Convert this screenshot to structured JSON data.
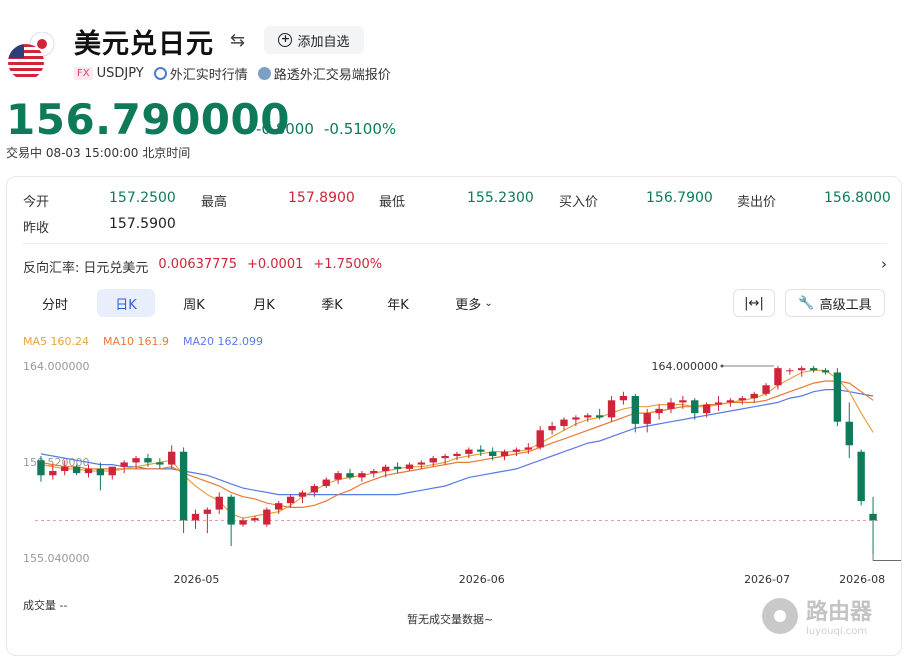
{
  "header": {
    "title": "美元兑日元",
    "add_watchlist": "添加自选",
    "fx_badge": "FX",
    "symbol": "USDJPY",
    "realtime": "外汇实时行情",
    "reuters": "路透外汇交易端报价",
    "price": "156.790000",
    "change": "-0.8000",
    "change_pct": "-0.5100%",
    "status": "交易中  08-03 15:00:00  北京时间"
  },
  "quote": {
    "open_label": "今开",
    "open": "157.2500",
    "high_label": "最高",
    "high": "157.8900",
    "low_label": "最低",
    "low": "155.2300",
    "bid_label": "买入价",
    "bid": "156.7900",
    "ask_label": "卖出价",
    "ask": "156.8000",
    "prev_label": "昨收",
    "prev": "157.5900"
  },
  "reverse": {
    "label": "反向汇率:",
    "pair": "日元兑美元",
    "rate": "0.00637775",
    "change": "+0.0001",
    "pct": "+1.7500%"
  },
  "tabs": [
    "分时",
    "日K",
    "周K",
    "月K",
    "季K",
    "年K",
    "更多"
  ],
  "tools": {
    "advanced": "高级工具"
  },
  "ma": {
    "ma5": "MA5 160.24",
    "ma10": "MA10 161.9",
    "ma20": "MA20 162.099"
  },
  "volume": {
    "label": "成交量 --",
    "empty": "暂无成交量数据~"
  },
  "watermark": {
    "text": "路由器",
    "sub": "luyouqi.com"
  },
  "colors": {
    "up": "#d0243a",
    "down": "#0e7a5a",
    "ma5": "#e8a33a",
    "ma10": "#e87a3a",
    "ma20": "#5a7ae8",
    "accent": "#2f5bd8"
  },
  "chart_data": {
    "type": "candlestick",
    "y_tick_labels": [
      "164.000000",
      "159.520000",
      "155.040000"
    ],
    "ylim": [
      155.04,
      164.0
    ],
    "x_tick_labels": [
      "2026-05",
      "2026-06",
      "2026-07",
      "2026-08"
    ],
    "annotations": {
      "max": "164.000000",
      "min": "155.040000"
    },
    "reference_line": 156.79,
    "candles": [
      [
        159.6,
        159.8,
        158.6,
        158.9
      ],
      [
        158.9,
        159.4,
        158.7,
        159.1
      ],
      [
        159.1,
        159.6,
        158.9,
        159.3
      ],
      [
        159.3,
        159.4,
        158.9,
        159.0
      ],
      [
        159.0,
        159.4,
        158.8,
        159.2
      ],
      [
        159.2,
        159.5,
        158.2,
        158.9
      ],
      [
        158.9,
        159.3,
        158.7,
        159.3
      ],
      [
        159.3,
        159.6,
        159.0,
        159.5
      ],
      [
        159.5,
        159.8,
        159.2,
        159.7
      ],
      [
        159.7,
        159.9,
        159.3,
        159.5
      ],
      [
        159.5,
        159.7,
        159.2,
        159.4
      ],
      [
        159.4,
        160.3,
        159.2,
        160.0
      ],
      [
        160.0,
        160.2,
        156.2,
        156.8
      ],
      [
        156.8,
        157.3,
        156.4,
        157.1
      ],
      [
        157.1,
        157.4,
        156.2,
        157.3
      ],
      [
        157.3,
        158.1,
        157.1,
        157.9
      ],
      [
        157.9,
        158.0,
        155.6,
        156.6
      ],
      [
        156.6,
        156.9,
        156.5,
        156.8
      ],
      [
        156.8,
        157.0,
        156.7,
        156.9
      ],
      [
        156.6,
        157.4,
        156.5,
        157.3
      ],
      [
        157.3,
        157.7,
        157.1,
        157.6
      ],
      [
        157.6,
        158.0,
        157.4,
        157.9
      ],
      [
        157.9,
        158.2,
        157.6,
        158.1
      ],
      [
        158.1,
        158.5,
        157.9,
        158.4
      ],
      [
        158.4,
        158.8,
        158.3,
        158.7
      ],
      [
        158.7,
        159.1,
        158.5,
        159.0
      ],
      [
        159.0,
        159.2,
        158.7,
        158.8
      ],
      [
        158.8,
        159.1,
        158.6,
        159.0
      ],
      [
        159.0,
        159.2,
        158.8,
        159.1
      ],
      [
        159.1,
        159.4,
        158.8,
        159.3
      ],
      [
        159.3,
        159.5,
        159.0,
        159.2
      ],
      [
        159.2,
        159.5,
        159.1,
        159.4
      ],
      [
        159.4,
        159.6,
        159.2,
        159.5
      ],
      [
        159.5,
        159.8,
        159.3,
        159.7
      ],
      [
        159.7,
        159.9,
        159.4,
        159.8
      ],
      [
        159.8,
        160.0,
        159.6,
        159.9
      ],
      [
        159.9,
        160.2,
        159.7,
        160.1
      ],
      [
        160.1,
        160.3,
        159.8,
        160.0
      ],
      [
        160.0,
        160.2,
        159.6,
        159.8
      ],
      [
        159.8,
        160.1,
        159.6,
        160.0
      ],
      [
        160.0,
        160.2,
        159.8,
        160.1
      ],
      [
        160.1,
        160.4,
        159.9,
        160.2
      ],
      [
        160.2,
        161.2,
        160.1,
        161.0
      ],
      [
        161.0,
        161.4,
        160.8,
        161.2
      ],
      [
        161.2,
        161.6,
        161.0,
        161.5
      ],
      [
        161.5,
        161.7,
        161.2,
        161.6
      ],
      [
        161.6,
        161.8,
        161.4,
        161.7
      ],
      [
        161.7,
        162.0,
        161.5,
        161.6
      ],
      [
        161.6,
        162.6,
        161.4,
        162.4
      ],
      [
        162.4,
        162.8,
        162.2,
        162.6
      ],
      [
        162.6,
        162.7,
        160.9,
        161.3
      ],
      [
        161.3,
        162.0,
        160.9,
        161.8
      ],
      [
        161.8,
        162.2,
        161.5,
        162.0
      ],
      [
        162.0,
        162.5,
        161.8,
        162.3
      ],
      [
        162.3,
        162.6,
        162.0,
        162.4
      ],
      [
        162.4,
        162.5,
        161.5,
        161.8
      ],
      [
        161.8,
        162.3,
        161.6,
        162.2
      ],
      [
        162.2,
        162.6,
        161.9,
        162.3
      ],
      [
        162.3,
        162.5,
        162.1,
        162.4
      ],
      [
        162.4,
        162.6,
        162.2,
        162.5
      ],
      [
        162.5,
        162.8,
        162.3,
        162.7
      ],
      [
        162.7,
        163.2,
        162.6,
        163.1
      ],
      [
        163.1,
        164.0,
        162.9,
        163.9
      ],
      [
        163.8,
        163.9,
        163.6,
        163.8
      ],
      [
        163.8,
        164.0,
        163.5,
        163.9
      ],
      [
        163.9,
        164.0,
        163.7,
        163.8
      ],
      [
        163.8,
        163.9,
        163.6,
        163.7
      ],
      [
        163.7,
        163.9,
        161.2,
        161.4
      ],
      [
        161.4,
        162.3,
        159.7,
        160.3
      ],
      [
        160.0,
        160.1,
        157.5,
        157.7
      ],
      [
        157.1,
        157.9,
        155.2,
        156.8
      ]
    ],
    "ma5": [
      159.4,
      159.3,
      159.2,
      159.2,
      159.1,
      159.1,
      159.1,
      159.2,
      159.3,
      159.4,
      159.5,
      159.6,
      158.9,
      158.4,
      158.0,
      157.7,
      157.1,
      156.9,
      157.0,
      157.1,
      157.2,
      157.5,
      157.9,
      158.2,
      158.5,
      158.7,
      158.8,
      158.9,
      159.0,
      159.1,
      159.2,
      159.3,
      159.3,
      159.4,
      159.5,
      159.7,
      159.8,
      159.9,
      160.0,
      160.0,
      160.0,
      160.1,
      160.4,
      160.7,
      161.0,
      161.3,
      161.5,
      161.6,
      161.8,
      162.0,
      162.1,
      162.1,
      162.2,
      162.2,
      162.2,
      162.1,
      162.1,
      162.2,
      162.3,
      162.4,
      162.5,
      162.7,
      163.1,
      163.4,
      163.7,
      163.8,
      163.8,
      163.4,
      162.8,
      161.8,
      160.9
    ],
    "ma10": [
      159.5,
      159.4,
      159.3,
      159.3,
      159.2,
      159.2,
      159.2,
      159.2,
      159.2,
      159.2,
      159.2,
      159.3,
      159.0,
      158.8,
      158.6,
      158.4,
      158.1,
      157.9,
      157.8,
      157.6,
      157.5,
      157.4,
      157.4,
      157.5,
      157.7,
      158.0,
      158.2,
      158.5,
      158.7,
      158.9,
      159.0,
      159.1,
      159.2,
      159.3,
      159.4,
      159.5,
      159.5,
      159.6,
      159.7,
      159.8,
      159.9,
      160.0,
      160.2,
      160.4,
      160.6,
      160.8,
      161.0,
      161.2,
      161.4,
      161.6,
      161.8,
      161.8,
      161.9,
      162.0,
      162.1,
      162.1,
      162.2,
      162.2,
      162.3,
      162.3,
      162.3,
      162.4,
      162.6,
      162.8,
      163.0,
      163.2,
      163.3,
      163.3,
      163.2,
      162.8,
      162.4
    ],
    "ma20": [
      159.9,
      159.8,
      159.7,
      159.6,
      159.5,
      159.4,
      159.4,
      159.3,
      159.3,
      159.2,
      159.2,
      159.2,
      159.1,
      159.0,
      158.9,
      158.7,
      158.5,
      158.3,
      158.2,
      158.1,
      158.0,
      158.0,
      158.0,
      158.0,
      158.0,
      158.0,
      158.0,
      158.0,
      158.0,
      158.0,
      158.0,
      158.1,
      158.2,
      158.3,
      158.4,
      158.6,
      158.8,
      158.9,
      159.0,
      159.1,
      159.2,
      159.4,
      159.6,
      159.8,
      160.0,
      160.2,
      160.4,
      160.5,
      160.7,
      160.9,
      161.1,
      161.2,
      161.3,
      161.4,
      161.5,
      161.6,
      161.7,
      161.8,
      161.9,
      162.0,
      162.1,
      162.2,
      162.3,
      162.5,
      162.6,
      162.8,
      162.9,
      162.9,
      162.8,
      162.7,
      162.6
    ]
  }
}
